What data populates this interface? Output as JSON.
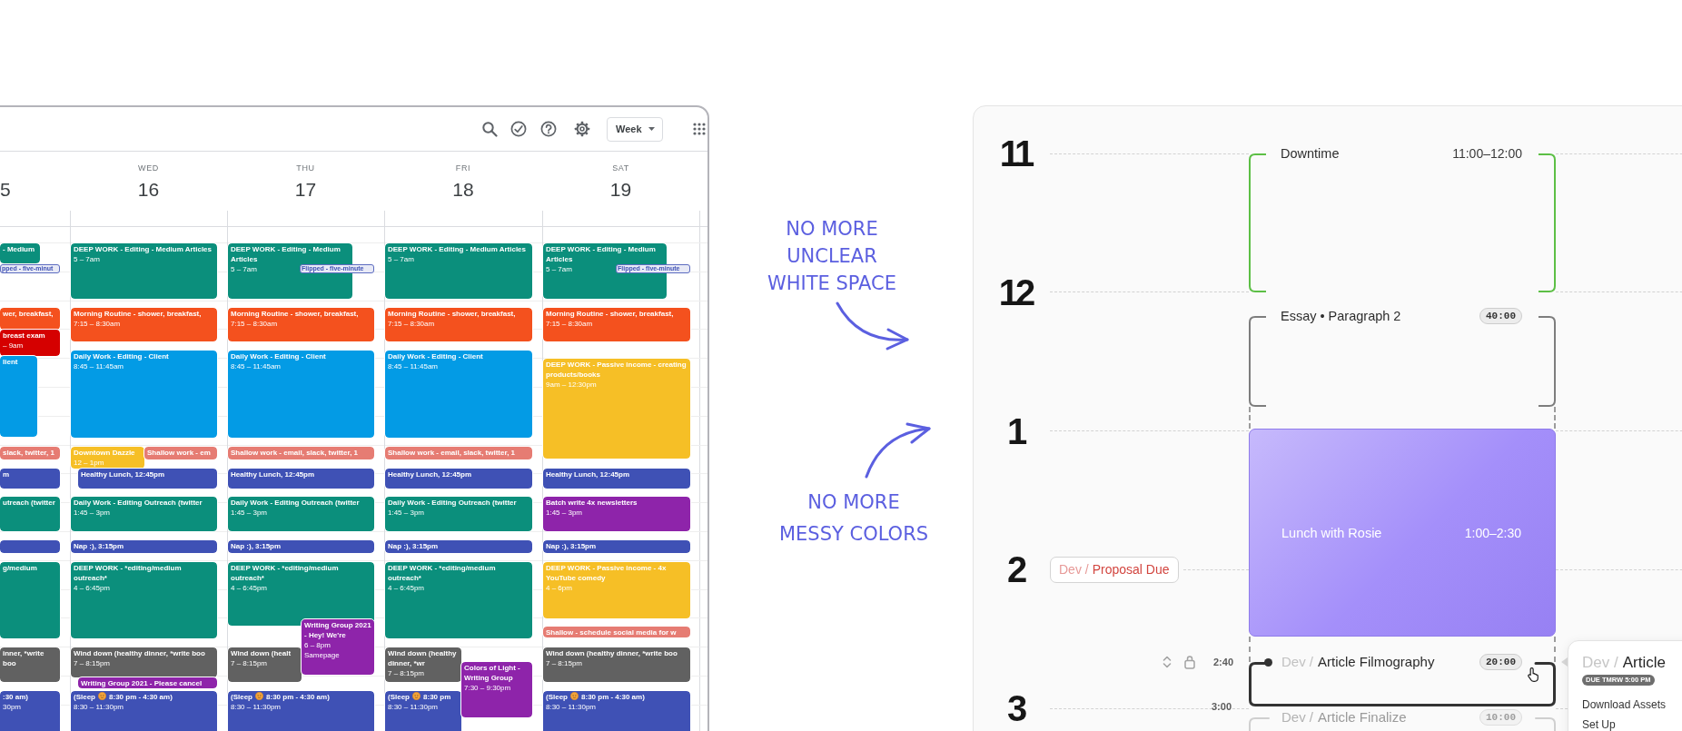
{
  "calendar": {
    "view_button": "Week",
    "days": [
      {
        "date": "5",
        "events": [
          {
            "kind": "block",
            "title": "- Medium",
            "color": "#0b8f7c"
          },
          {
            "kind": "chip",
            "title": "pped - five-minut",
            "color": "#5c6bc0"
          },
          {
            "kind": "block",
            "title": "wer, breakfast,",
            "color": "#f4511e"
          },
          {
            "kind": "block",
            "title": "breast exam",
            "time": "– 9am",
            "color": "#d50000"
          },
          {
            "kind": "block",
            "title": "lient",
            "color": "#039be5"
          },
          {
            "kind": "block",
            "title": "slack, twitter, 1",
            "color": "#e67c73"
          },
          {
            "kind": "block",
            "title": "m",
            "color": "#3f51b5"
          },
          {
            "kind": "block",
            "title": "utreach (twitter",
            "color": "#0b8f7c"
          },
          {
            "kind": "block",
            "color": "#3f51b5"
          },
          {
            "kind": "block",
            "title": "g/medium",
            "color": "#0b8f7c"
          },
          {
            "kind": "block",
            "title": "inner, *write boo",
            "color": "#616161"
          },
          {
            "kind": "block",
            "title": ":30 am)",
            "time": "30pm",
            "color": "#3f51b5"
          }
        ]
      },
      {
        "weekday": "WED",
        "date": "16",
        "events": [
          {
            "kind": "block",
            "title": "DEEP WORK - Editing - Medium Articles",
            "time": "5 – 7am",
            "color": "#0b8f7c"
          },
          {
            "kind": "block",
            "title": "Morning Routine - shower, breakfast,",
            "time": "7:15 – 8:30am",
            "color": "#f4511e"
          },
          {
            "kind": "block",
            "title": "Daily Work - Editing - Client",
            "time": "8:45 – 11:45am",
            "color": "#039be5"
          },
          {
            "kind": "block",
            "title": "Downtown Dazzle",
            "time": "12 – 1pm",
            "color": "#f6bf26"
          },
          {
            "kind": "block",
            "title": "Shallow work - em",
            "color": "#e67c73"
          },
          {
            "kind": "block",
            "title": "Healthy Lunch, 12:45pm",
            "color": "#3f51b5"
          },
          {
            "kind": "block",
            "title": "Daily Work - Editing Outreach (twitter",
            "time": "1:45 – 3pm",
            "color": "#0b8f7c"
          },
          {
            "kind": "block",
            "title": "Nap :), 3:15pm",
            "color": "#3f51b5"
          },
          {
            "kind": "block",
            "title": "DEEP WORK - *editing/medium outreach*",
            "time": "4 – 6:45pm",
            "color": "#0b8f7c"
          },
          {
            "kind": "block",
            "title": "Wind down (healthy dinner, *write boo",
            "time": "7 – 8:15pm",
            "color": "#616161"
          },
          {
            "kind": "block",
            "title": "Writing Group 2021 - Please cancel",
            "color": "#8e24aa"
          },
          {
            "kind": "block",
            "title": "(Sleep",
            "emoji": true,
            "title_end": "8:30 pm - 4:30 am)",
            "time": "8:30 – 11:30pm",
            "color": "#3f51b5"
          }
        ]
      },
      {
        "weekday": "THU",
        "date": "17",
        "events": [
          {
            "kind": "block",
            "title": "DEEP WORK - Editing - Medium Articles",
            "time": "5 – 7am",
            "color": "#0b8f7c"
          },
          {
            "kind": "chip",
            "title": "Flipped - five-minute",
            "color": "#5c6bc0"
          },
          {
            "kind": "block",
            "title": "Morning Routine - shower, breakfast,",
            "time": "7:15 – 8:30am",
            "color": "#f4511e"
          },
          {
            "kind": "block",
            "title": "Daily Work - Editing - Client",
            "time": "8:45 – 11:45am",
            "color": "#039be5"
          },
          {
            "kind": "block",
            "title": "Shallow work - email, slack, twitter, 1",
            "color": "#e67c73"
          },
          {
            "kind": "block",
            "title": "Healthy Lunch, 12:45pm",
            "color": "#3f51b5"
          },
          {
            "kind": "block",
            "title": "Daily Work - Editing Outreach (twitter",
            "time": "1:45 – 3pm",
            "color": "#0b8f7c"
          },
          {
            "kind": "block",
            "title": "Nap :), 3:15pm",
            "color": "#3f51b5"
          },
          {
            "kind": "block",
            "title": "DEEP WORK - *editing/medium outreach*",
            "time": "4 – 6:45pm",
            "color": "#0b8f7c"
          },
          {
            "kind": "block",
            "title": "Wind down (healt",
            "time": "7 – 8:15pm",
            "color": "#616161"
          },
          {
            "kind": "block",
            "title": "Writing Group 2021 - Hey! We're",
            "time": "6 – 8pm",
            "location": "Samepage",
            "color": "#8e24aa"
          },
          {
            "kind": "block",
            "title": "(Sleep",
            "emoji": true,
            "title_end": "8:30 pm - 4:30 am)",
            "time": "8:30 – 11:30pm",
            "color": "#3f51b5"
          }
        ]
      },
      {
        "weekday": "FRI",
        "date": "18",
        "events": [
          {
            "kind": "block",
            "title": "DEEP WORK - Editing - Medium Articles",
            "time": "5 – 7am",
            "color": "#0b8f7c"
          },
          {
            "kind": "block",
            "title": "Morning Routine - shower, breakfast,",
            "time": "7:15 – 8:30am",
            "color": "#f4511e"
          },
          {
            "kind": "block",
            "title": "Daily Work - Editing - Client",
            "time": "8:45 – 11:45am",
            "color": "#039be5"
          },
          {
            "kind": "block",
            "title": "Shallow work - email, slack, twitter, 1",
            "color": "#e67c73"
          },
          {
            "kind": "block",
            "title": "Healthy Lunch, 12:45pm",
            "color": "#3f51b5"
          },
          {
            "kind": "block",
            "title": "Daily Work - Editing Outreach (twitter",
            "time": "1:45 – 3pm",
            "color": "#0b8f7c"
          },
          {
            "kind": "block",
            "title": "Nap :), 3:15pm",
            "color": "#3f51b5"
          },
          {
            "kind": "block",
            "title": "DEEP WORK - *editing/medium outreach*",
            "time": "4 – 6:45pm",
            "color": "#0b8f7c"
          },
          {
            "kind": "block",
            "title": "Wind down (healthy dinner, *wr",
            "time": "7 – 8:15pm",
            "color": "#616161"
          },
          {
            "kind": "block",
            "title": "(Sleep",
            "emoji": true,
            "title_end": "8:30 pm",
            "time": "8:30 – 11:30pm",
            "color": "#3f51b5"
          },
          {
            "kind": "block",
            "title": "Colors of Light - Writing Group",
            "time": "7:30 – 9:30pm",
            "color": "#8e24aa"
          }
        ]
      },
      {
        "weekday": "SAT",
        "date": "19",
        "events": [
          {
            "kind": "block",
            "title": "DEEP WORK - Editing - Medium Articles",
            "time": "5 – 7am",
            "color": "#0b8f7c"
          },
          {
            "kind": "chip",
            "title": "Flipped - five-minute",
            "color": "#5c6bc0"
          },
          {
            "kind": "block",
            "title": "Morning Routine - shower, breakfast,",
            "time": "7:15 – 8:30am",
            "color": "#f4511e"
          },
          {
            "kind": "block",
            "title": "DEEP WORK - Passive income - creating products/books",
            "time": "9am – 12:30pm",
            "color": "#f6bf26"
          },
          {
            "kind": "block",
            "title": "Healthy Lunch, 12:45pm",
            "color": "#3f51b5"
          },
          {
            "kind": "block",
            "title": "Batch write 4x newsletters",
            "time": "1:45 – 3pm",
            "color": "#8e24aa"
          },
          {
            "kind": "block",
            "title": "Nap :), 3:15pm",
            "color": "#3f51b5"
          },
          {
            "kind": "block",
            "title": "DEEP WORK - Passive income - 4x YouTube comedy",
            "time": "4 – 6pm",
            "color": "#f6bf26"
          },
          {
            "kind": "block",
            "title": "Shallow - schedule social media for w",
            "color": "#e67c73"
          },
          {
            "kind": "block",
            "title": "Wind down (healthy dinner, *write boo",
            "time": "7 – 8:15pm",
            "color": "#616161"
          },
          {
            "kind": "block",
            "title": "(Sleep",
            "emoji": true,
            "title_end": "8:30 pm - 4:30 am)",
            "time": "8:30 – 11:30pm",
            "color": "#3f51b5"
          }
        ]
      }
    ]
  },
  "annotations": [
    {
      "lines": [
        "NO MORE",
        "UNCLEAR",
        "WHITE SPACE"
      ]
    },
    {
      "lines": [
        "NO MORE",
        "MESSY COLORS"
      ]
    }
  ],
  "planner": {
    "hours": [
      {
        "label": "11"
      },
      {
        "label": "12"
      },
      {
        "label": "1"
      },
      {
        "label": "2",
        "deadline": {
          "project": "Dev /",
          "title": "Proposal Due"
        }
      },
      {
        "label": "3"
      }
    ],
    "blocks": [
      {
        "kind": "bracket",
        "title": "Downtime",
        "time": "11:00–12:00",
        "color": "#5cbf45"
      },
      {
        "kind": "bracket",
        "title": "Essay • Paragraph 2",
        "timer": "40:00",
        "color": "#7d7d7d"
      },
      {
        "kind": "filled",
        "title": "Lunch with Rosie",
        "time": "1:00–2:30",
        "color": "#a48ffa"
      },
      {
        "kind": "task",
        "project": "Dev /",
        "title": "Article Filmography",
        "timer": "20:00",
        "start": "2:40",
        "end": "3:00",
        "selected": true
      },
      {
        "kind": "task",
        "project": "Dev /",
        "title": "Article Finalize",
        "timer": "10:00",
        "selected": false
      }
    ],
    "popover": {
      "project": "Dev /",
      "title": "Article",
      "badge": "DUE TMRW 5:00 PM",
      "items": [
        "Download Assets",
        "Set Up"
      ]
    }
  }
}
